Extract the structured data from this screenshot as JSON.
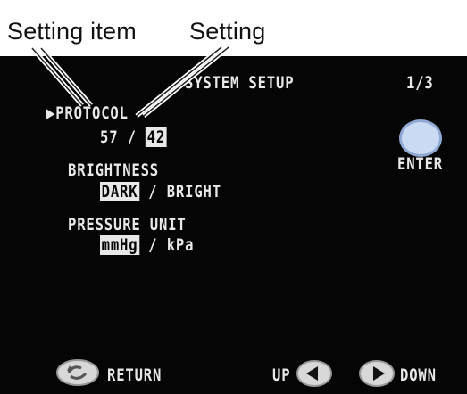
{
  "callouts": {
    "setting_item": "Setting item",
    "setting": "Setting"
  },
  "screen": {
    "title": "SYSTEM SETUP",
    "page": "1/3",
    "cursor_glyph": "▶",
    "enter_label": "ENTER",
    "items": [
      {
        "label": "PROTOCOL",
        "options": [
          "57",
          "42"
        ],
        "separator": "/",
        "selected": "42"
      },
      {
        "label": "BRIGHTNESS",
        "options": [
          "DARK",
          "BRIGHT"
        ],
        "separator": "/",
        "selected": "DARK"
      },
      {
        "label": "PRESSURE UNIT",
        "options": [
          "mmHg",
          "kPa"
        ],
        "separator": "/",
        "selected": "mmHg"
      }
    ],
    "footer": {
      "return_label": "RETURN",
      "up_label": "UP",
      "down_label": "DOWN"
    }
  },
  "colors": {
    "screen_bg": "#050505",
    "osd_text": "#e8e8e8",
    "enter_button": "#c9daf2"
  }
}
